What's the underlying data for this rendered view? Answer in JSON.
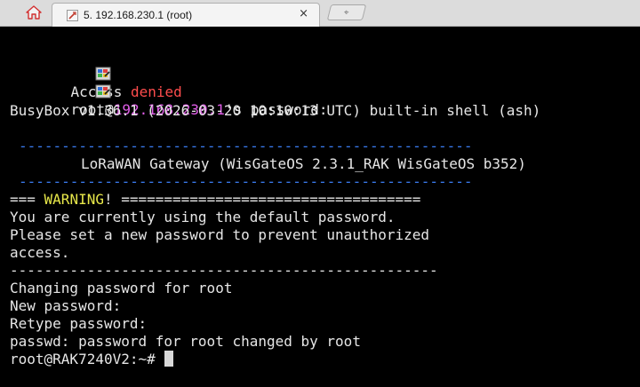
{
  "tabs": {
    "session_title": "5. 192.168.230.1 (root)",
    "close_glyph": "×",
    "new_tab_glyph": "⌖"
  },
  "terminal": {
    "line1": {
      "prefix": "Access ",
      "denied": "denied"
    },
    "line2": {
      "user": "root@",
      "host": "192.168.230.1",
      "rest": "'s password:"
    },
    "busybox": "BusyBox v1.36.1 (2026-03-20 10:10:13 UTC) built-in shell (ash)",
    "dash_long": "-----------------------------------------------------",
    "gateway": "LoRaWAN Gateway (WisGateOS 2.3.1_RAK WisGateOS b352)",
    "warning_lead": "===",
    "warning_word": " WARNING",
    "warning_rest": "! ===================================",
    "warn1": "You are currently using the default password.",
    "warn2": "Please set a new password to prevent unauthorized",
    "warn3": "access.",
    "dash_sep": "--------------------------------------------------",
    "chg1": "Changing password for root",
    "chg2": "New password:",
    "chg3": "Retype password:",
    "chg4": "passwd: password for root changed by root",
    "prompt": "root@RAK7240V2:~#"
  },
  "colors": {
    "denied": "#ff4d4d",
    "host": "#e05ee8",
    "banner_dashes": "#3a7cf0",
    "warning": "#e8e84a"
  },
  "icons": {
    "home": "home-icon",
    "session": "ssh-terminal-icon",
    "mobaxterm": "mobaxterm-logo-icon"
  }
}
